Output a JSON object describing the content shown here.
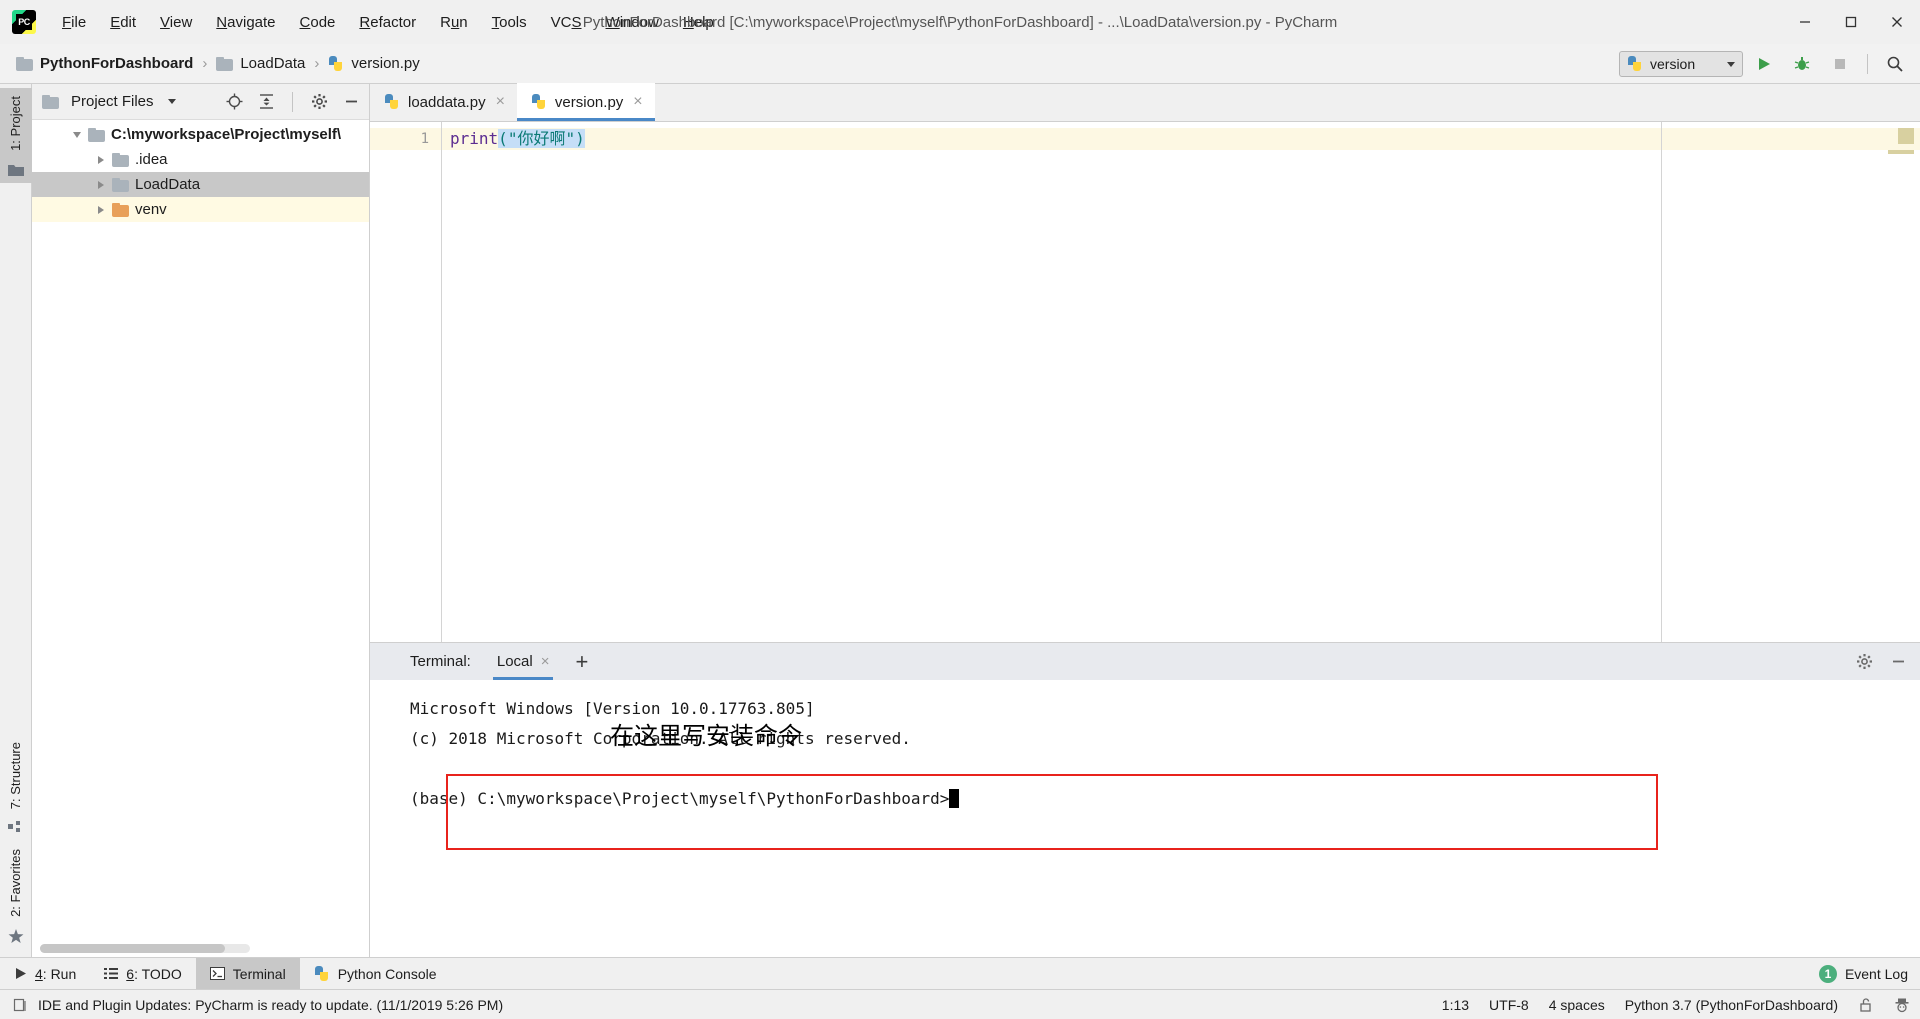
{
  "window": {
    "title": "PythonForDashboard [C:\\myworkspace\\Project\\myself\\PythonForDashboard] - ...\\LoadData\\version.py - PyCharm",
    "app_logo": "pycharm-logo",
    "minimize_label": "Minimize",
    "maximize_label": "Maximize",
    "close_label": "Close"
  },
  "menubar": {
    "items": [
      {
        "label": "File",
        "mnemonic": "F"
      },
      {
        "label": "Edit",
        "mnemonic": "E"
      },
      {
        "label": "View",
        "mnemonic": "V"
      },
      {
        "label": "Navigate",
        "mnemonic": "N"
      },
      {
        "label": "Code",
        "mnemonic": "C"
      },
      {
        "label": "Refactor",
        "mnemonic": "R"
      },
      {
        "label": "Run",
        "mnemonic": "u"
      },
      {
        "label": "Tools",
        "mnemonic": "T"
      },
      {
        "label": "VCS",
        "mnemonic": "S"
      },
      {
        "label": "Window",
        "mnemonic": "W"
      },
      {
        "label": "Help",
        "mnemonic": "H"
      }
    ]
  },
  "navbar": {
    "breadcrumbs": [
      {
        "label": "PythonForDashboard",
        "icon": "folder-icon"
      },
      {
        "label": "LoadData",
        "icon": "folder-icon"
      },
      {
        "label": "version.py",
        "icon": "python-file-icon"
      }
    ],
    "separator": "›",
    "run_config": {
      "label": "version",
      "icon": "python-icon"
    },
    "buttons": [
      {
        "name": "run-button",
        "label": "Run"
      },
      {
        "name": "debug-button",
        "label": "Debug"
      },
      {
        "name": "stop-button",
        "label": "Stop"
      },
      {
        "name": "search-button",
        "label": "Search Everywhere"
      }
    ]
  },
  "left_stripe": {
    "top_tabs": [
      {
        "label": "1: Project",
        "mnemonic": "1",
        "active": true,
        "icon": "project-folder-icon"
      }
    ],
    "bottom_tabs": [
      {
        "label": "7: Structure",
        "mnemonic": "7",
        "active": false,
        "icon": "structure-icon"
      },
      {
        "label": "2: Favorites",
        "mnemonic": "2",
        "active": false,
        "icon": "star-icon"
      }
    ]
  },
  "project_panel": {
    "header": {
      "title": "Project Files",
      "icons": [
        "dropdown-icon",
        "locate-icon",
        "collapse-all-icon",
        "gear-icon",
        "hide-icon"
      ]
    },
    "tree": [
      {
        "label": "C:\\myworkspace\\Project\\myself\\",
        "indent": 0,
        "expanded": true,
        "bold": true,
        "icon": "folder-icon",
        "state": "normal"
      },
      {
        "label": ".idea",
        "indent": 1,
        "expanded": false,
        "bold": false,
        "icon": "folder-icon",
        "state": "normal"
      },
      {
        "label": "LoadData",
        "indent": 1,
        "expanded": false,
        "bold": false,
        "icon": "folder-icon",
        "state": "selected"
      },
      {
        "label": "venv",
        "indent": 1,
        "expanded": false,
        "bold": false,
        "icon": "folder-orange-icon",
        "state": "highlighted"
      }
    ]
  },
  "editor": {
    "tabs": [
      {
        "label": "loaddata.py",
        "icon": "python-file-icon",
        "active": false,
        "close": "×"
      },
      {
        "label": "version.py",
        "icon": "python-file-icon",
        "active": true,
        "close": "×"
      }
    ],
    "lines": [
      {
        "number": "1",
        "tokens": [
          {
            "text": "print",
            "type": "function"
          },
          {
            "text": "(",
            "type": "paren-selected"
          },
          {
            "text": "\"你好啊\"",
            "type": "string-selected"
          },
          {
            "text": ")",
            "type": "paren-selected"
          }
        ]
      }
    ]
  },
  "terminal": {
    "header": {
      "label": "Terminal:",
      "tab": {
        "label": "Local",
        "close": "×"
      },
      "add": "+",
      "right_icons": [
        "gear-icon",
        "hide-icon"
      ]
    },
    "lines": [
      "Microsoft Windows [Version 10.0.17763.805]",
      "(c) 2018 Microsoft Corporation. All rights reserved.",
      "",
      "(base) C:\\myworkspace\\Project\\myself\\PythonForDashboard>"
    ],
    "annotation": "在这里写安装命令",
    "annotation_box_color": "#e8231c"
  },
  "bottom_tool_strip": {
    "tabs": [
      {
        "label": "4: Run",
        "mnemonic": "4",
        "icon": "run-icon",
        "active": false
      },
      {
        "label": "6: TODO",
        "mnemonic": "6",
        "icon": "todo-list-icon",
        "active": false
      },
      {
        "label": "Terminal",
        "mnemonic": "",
        "icon": "terminal-icon",
        "active": true
      },
      {
        "label": "Python Console",
        "mnemonic": "",
        "icon": "python-icon",
        "active": false
      }
    ],
    "event_log": {
      "label": "Event Log",
      "count": "1"
    }
  },
  "status_bar": {
    "message": "IDE and Plugin Updates: PyCharm is ready to update. (11/1/2019 5:26 PM)",
    "message_icon": "notification-icon",
    "caret_position": "1:13",
    "encoding": "UTF-8",
    "indent": "4 spaces",
    "interpreter": "Python 3.7 (PythonForDashboard)",
    "lock_icon": "unlock-icon",
    "hector_icon": "hector-icon"
  },
  "colors": {
    "accent": "#4a88c7",
    "selection": "#c5def7",
    "current_line": "#fdf8e3",
    "annotation_red": "#e8231c",
    "chrome": "#f0f0f0"
  }
}
